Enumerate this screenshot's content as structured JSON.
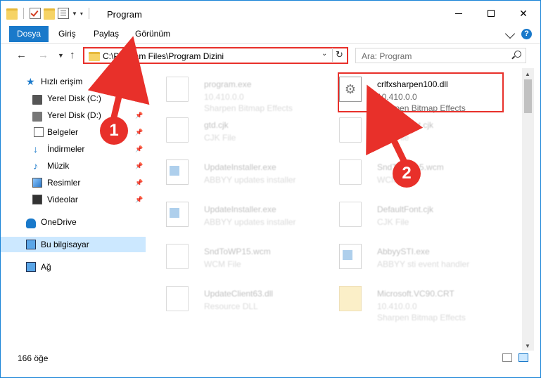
{
  "window": {
    "title": "Program"
  },
  "ribbon": {
    "tabs": [
      "Dosya",
      "Giriş",
      "Paylaş",
      "Görünüm"
    ]
  },
  "address": {
    "path": "C:\\Program Files\\Program Dizini"
  },
  "search": {
    "placeholder": "Ara: Program"
  },
  "sidebar": {
    "items": [
      {
        "label": "Hızlı erişim",
        "icon": "star-icon"
      },
      {
        "label": "Yerel Disk (C:)",
        "icon": "drive-icon",
        "pinned": true
      },
      {
        "label": "Yerel Disk (D:)",
        "icon": "drive-icon",
        "pinned": true
      },
      {
        "label": "Belgeler",
        "icon": "documents-icon",
        "pinned": true
      },
      {
        "label": "İndirmeler",
        "icon": "download-icon",
        "pinned": true
      },
      {
        "label": "Müzik",
        "icon": "music-icon",
        "pinned": true
      },
      {
        "label": "Resimler",
        "icon": "pictures-icon",
        "pinned": true
      },
      {
        "label": "Videolar",
        "icon": "videos-icon",
        "pinned": true
      },
      {
        "label": "OneDrive",
        "icon": "onedrive-icon"
      },
      {
        "label": "Bu bilgisayar",
        "icon": "computer-icon",
        "selected": true
      },
      {
        "label": "Ağ",
        "icon": "network-icon"
      }
    ]
  },
  "files": [
    {
      "name": "program.exe",
      "line1": "10.410.0.0",
      "line2": "Sharpen Bitmap Effects",
      "icon": "app-icon",
      "faded": true
    },
    {
      "name": "crlfxsharpen100.dll",
      "line1": "10.410.0.0",
      "line2": "Sharpen Bitmap Effects",
      "icon": "dll-gear-icon",
      "faded": false
    },
    {
      "name": "gtd.cjk",
      "line1": "CJK File",
      "line2": "",
      "icon": "page-icon",
      "faded": true
    },
    {
      "name": "DefaultFont.cjk",
      "line1": "CJK File",
      "line2": "",
      "icon": "page-icon",
      "faded": true
    },
    {
      "name": "UpdateInstaller.exe",
      "line1": "ABBYY updates installer",
      "line2": "",
      "icon": "window-icon",
      "faded": true
    },
    {
      "name": "SndToWP15.wcm",
      "line1": "WCM File",
      "line2": "",
      "icon": "page-icon",
      "faded": true
    },
    {
      "name": "UpdateInstaller.exe",
      "line1": "ABBYY updates installer",
      "line2": "",
      "icon": "window-icon",
      "faded": true
    },
    {
      "name": "DefaultFont.cjk",
      "line1": "CJK File",
      "line2": "",
      "icon": "page-icon",
      "faded": true
    },
    {
      "name": "SndToWP15.wcm",
      "line1": "WCM File",
      "line2": "",
      "icon": "page-icon",
      "faded": true
    },
    {
      "name": "AbbyySTI.exe",
      "line1": "ABBYY sti event handler",
      "line2": "",
      "icon": "window-icon",
      "faded": true
    },
    {
      "name": "UpdateClient63.dll",
      "line1": "Resource DLL",
      "line2": "",
      "icon": "page-icon",
      "faded": true
    },
    {
      "name": "Microsoft.VC90.CRT",
      "line1": "10.410.0.0",
      "line2": "Sharpen Bitmap Effects",
      "icon": "folder-icon",
      "faded": true
    }
  ],
  "status": {
    "count": "166 öğe"
  },
  "annotations": [
    {
      "label": "1"
    },
    {
      "label": "2"
    }
  ],
  "colors": {
    "accent": "#1979ca",
    "highlight": "#e8302a",
    "selected": "#cce8ff"
  }
}
